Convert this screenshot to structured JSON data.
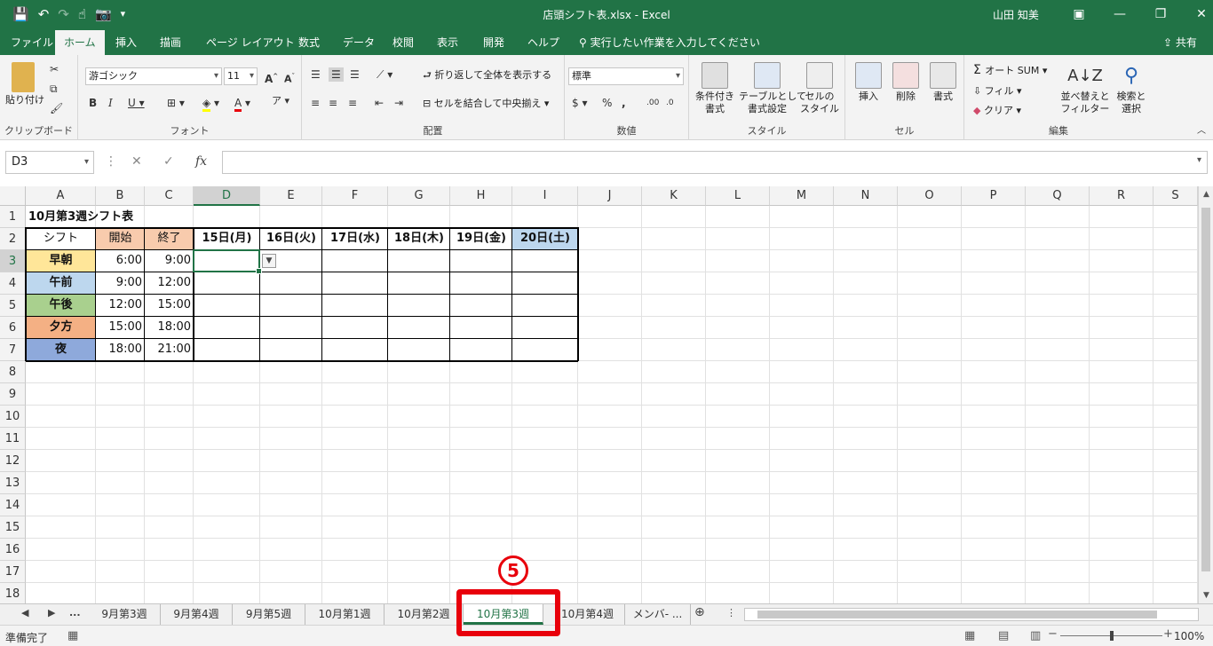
{
  "titlebar": {
    "title": "店頭シフト表.xlsx  -  Excel",
    "user": "山田 知美",
    "qat_icons": [
      "save-icon",
      "undo-icon",
      "redo-icon",
      "touch-mode-icon",
      "camera-icon",
      "customize-icon"
    ]
  },
  "tabs": [
    {
      "label": "ファイル",
      "active": false
    },
    {
      "label": "ホーム",
      "active": true
    },
    {
      "label": "挿入",
      "active": false
    },
    {
      "label": "描画",
      "active": false
    },
    {
      "label": "ページ レイアウト",
      "active": false
    },
    {
      "label": "数式",
      "active": false
    },
    {
      "label": "データ",
      "active": false
    },
    {
      "label": "校閲",
      "active": false
    },
    {
      "label": "表示",
      "active": false
    },
    {
      "label": "開発",
      "active": false
    },
    {
      "label": "ヘルプ",
      "active": false
    }
  ],
  "tell_me": "実行したい作業を入力してください",
  "share": "共有",
  "ribbon": {
    "groups": {
      "clipboard": "クリップボード",
      "font": "フォント",
      "alignment": "配置",
      "number": "数値",
      "styles": "スタイル",
      "cells": "セル",
      "editing": "編集"
    },
    "paste": "貼り付け",
    "font_name": "游ゴシック",
    "font_size": "11",
    "wrap_text": "折り返して全体を表示する",
    "merge_center": "セルを結合して中央揃え",
    "number_format": "標準",
    "conditional_formatting": [
      "条件付き",
      "書式"
    ],
    "format_as_table": [
      "テーブルとして",
      "書式設定"
    ],
    "cell_styles": [
      "セルの",
      "スタイル"
    ],
    "insert": "挿入",
    "delete": "削除",
    "format": "書式",
    "autosum": "オート SUM",
    "fill": "フィル",
    "clear": "クリア",
    "sort_filter": [
      "並べ替えと",
      "フィルター"
    ],
    "find_select": [
      "検索と",
      "選択"
    ]
  },
  "formula_bar": {
    "name_box": "D3",
    "formula": ""
  },
  "columns": [
    "A",
    "B",
    "C",
    "D",
    "E",
    "F",
    "G",
    "H",
    "I",
    "J",
    "K",
    "L",
    "M",
    "N",
    "O",
    "P",
    "Q",
    "R",
    "S"
  ],
  "rows": [
    "1",
    "2",
    "3",
    "4",
    "5",
    "6",
    "7",
    "8",
    "9",
    "10",
    "11",
    "12",
    "13",
    "14",
    "15",
    "16",
    "17",
    "18"
  ],
  "sheet": {
    "title": "10月第3週シフト表",
    "header": [
      "シフト",
      "開始",
      "終了",
      "15日(月)",
      "16日(火)",
      "17日(水)",
      "18日(木)",
      "19日(金)",
      "20日(土)"
    ],
    "shifts": [
      {
        "name": "早朝",
        "start": "6:00",
        "end": "9:00"
      },
      {
        "name": "午前",
        "start": "9:00",
        "end": "12:00"
      },
      {
        "name": "午後",
        "start": "12:00",
        "end": "15:00"
      },
      {
        "name": "夕方",
        "start": "15:00",
        "end": "18:00"
      },
      {
        "name": "夜",
        "start": "18:00",
        "end": "21:00"
      }
    ]
  },
  "colors": {
    "excel_green": "#217346",
    "shift_fill": [
      "#ffe699",
      "#bdd7ee",
      "#a9d08e",
      "#f4b084",
      "#8ea9db"
    ],
    "time_header_fill": "#f8cbad",
    "saturday_fill": "#bdd7ee",
    "annotation_red": "#e8000b"
  },
  "sheet_tabs": [
    "9月第3週",
    "9月第4週",
    "9月第5週",
    "10月第1週",
    "10月第2週",
    "10月第3週",
    "10月第4週",
    "メンバ-  ..."
  ],
  "active_sheet_tab": "10月第3週",
  "status": {
    "ready": "準備完了",
    "zoom": "100%"
  },
  "annotation": {
    "step": "5"
  }
}
